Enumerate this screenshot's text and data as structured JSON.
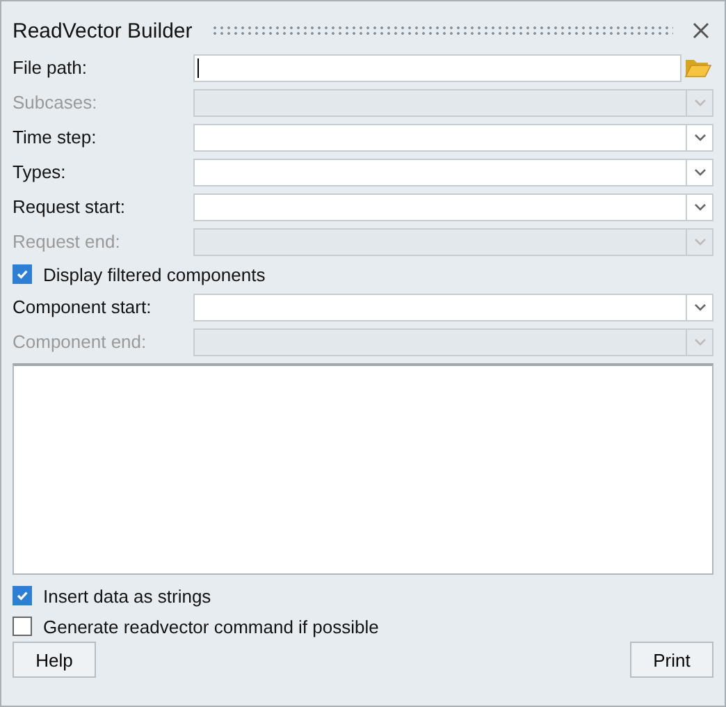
{
  "window": {
    "title": "ReadVector Builder"
  },
  "fields": [
    {
      "kind": "file",
      "label": "File path:",
      "disabled": false
    },
    {
      "kind": "combo",
      "label": "Subcases:",
      "disabled": true
    },
    {
      "kind": "combo",
      "label": "Time step:",
      "disabled": false
    },
    {
      "kind": "combo",
      "label": "Types:",
      "disabled": false
    },
    {
      "kind": "combo",
      "label": "Request start:",
      "disabled": false
    },
    {
      "kind": "combo",
      "label": "Request end:",
      "disabled": true
    },
    {
      "kind": "checkbox",
      "label": "Display filtered components",
      "checked": true
    },
    {
      "kind": "combo",
      "label": "Component start:",
      "disabled": false
    },
    {
      "kind": "combo",
      "label": "Component end:",
      "disabled": true
    }
  ],
  "options": [
    {
      "label": "Insert data as strings",
      "checked": true
    },
    {
      "label": "Generate readvector command if possible",
      "checked": false
    }
  ],
  "buttons": [
    "Help",
    "Print"
  ]
}
